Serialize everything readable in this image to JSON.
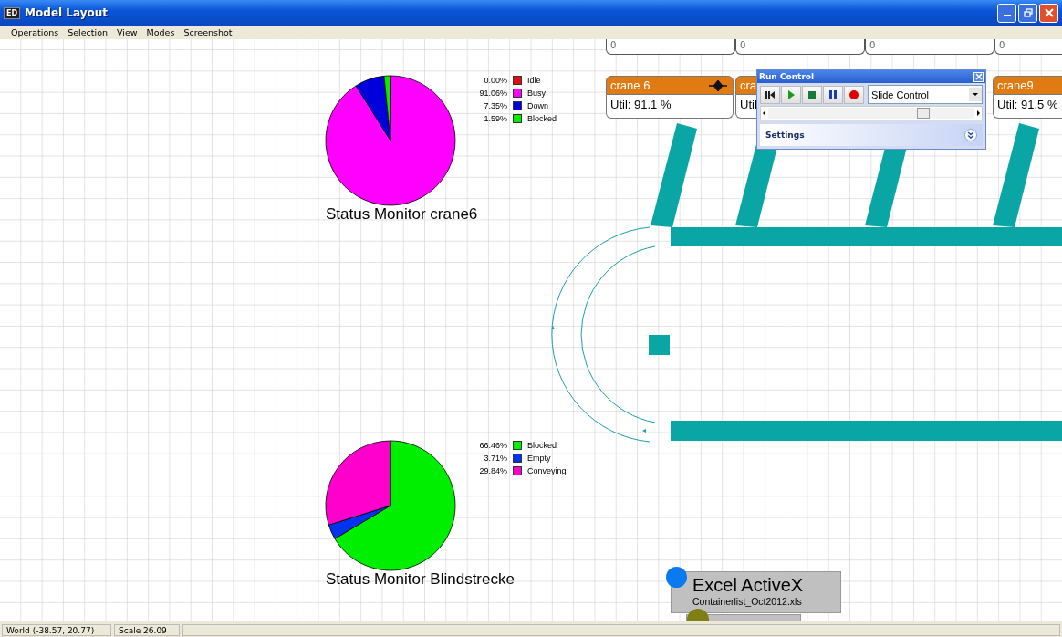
{
  "window": {
    "title": "Model Layout",
    "app_icon": "ED"
  },
  "menu": [
    "Operations",
    "Selection",
    "View",
    "Modes",
    "Screenshot"
  ],
  "counters": [
    {
      "value": "0"
    },
    {
      "value": "0"
    },
    {
      "value": "0"
    },
    {
      "value": "0"
    }
  ],
  "cranes": [
    {
      "name": "crane 6",
      "util": "Util: 91.1 %",
      "marker": true
    },
    {
      "name": "cra",
      "util": "Util"
    },
    {
      "name": "crane9",
      "util": "Util: 91.5 %"
    }
  ],
  "monitors": [
    {
      "title": "Status Monitor crane6",
      "legend_entries": [
        {
          "pct": "0.00%",
          "color": "#e01010"
        },
        {
          "pct": "91.06%",
          "color": "#ff00ff"
        },
        {
          "pct": "7.35%",
          "color": "#0000dd"
        },
        {
          "pct": "1.59%",
          "color": "#00ee00"
        }
      ],
      "chart_data": {
        "type": "pie",
        "legend": "right",
        "categories": [
          "Idle",
          "Busy",
          "Down",
          "Blocked"
        ],
        "values": [
          0.0,
          91.06,
          7.35,
          1.59
        ]
      }
    },
    {
      "title": "Status Monitor Blindstrecke",
      "legend_entries": [
        {
          "pct": "66.46%",
          "color": "#00ee00"
        },
        {
          "pct": "3.71%",
          "color": "#0033ee"
        },
        {
          "pct": "29.84%",
          "color": "#ff00cc"
        }
      ],
      "chart_data": {
        "type": "pie",
        "legend": "right",
        "categories": [
          "Blocked",
          "Empty",
          "Conveying"
        ],
        "values": [
          66.46,
          3.71,
          29.84
        ]
      }
    }
  ],
  "run_control": {
    "title": "Run Control",
    "mode": "Slide Control",
    "speed": {
      "level": 0.75
    },
    "settings_label": "Settings"
  },
  "excel": {
    "title": "Excel ActiveX",
    "file": "Containerlist_Oct2012.xls"
  },
  "status_bar": [
    "World (-38.57, 20.77)",
    "Scale 26.09"
  ]
}
